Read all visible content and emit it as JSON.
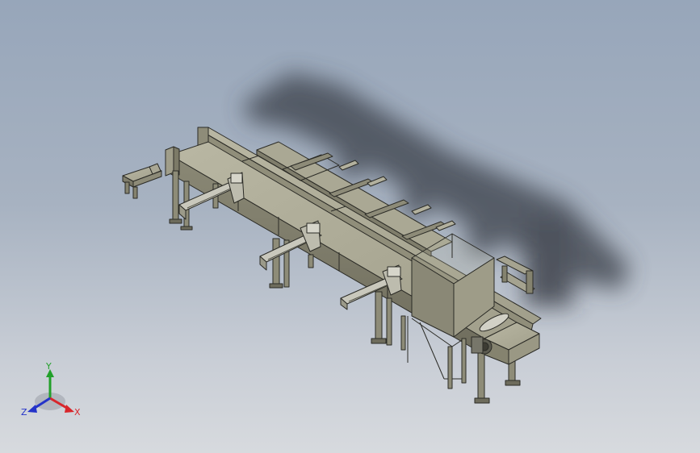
{
  "viewport": {
    "background_top": "#97a6ba",
    "background_bottom": "#d7dade",
    "model_color": "#9c9a86",
    "model_edge": "#2b2b26"
  },
  "triad": {
    "y_label": "Y",
    "x_label": "X",
    "z_label": "Z",
    "y_color": "#22a02a",
    "x_color": "#d8262b",
    "z_color": "#2433c9"
  }
}
